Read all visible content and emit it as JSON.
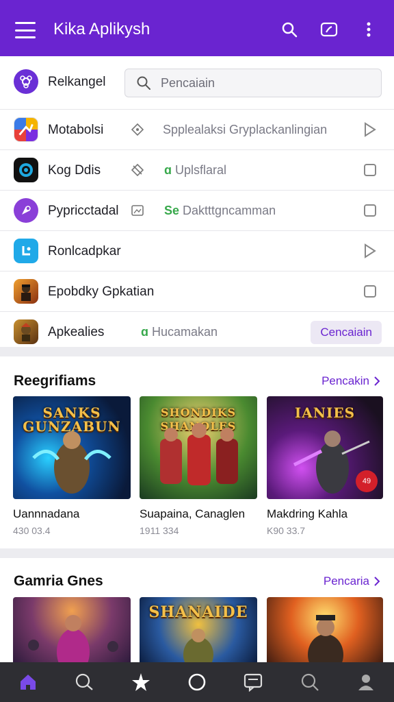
{
  "appbar": {
    "title": "Kika Aplikysh",
    "icons": [
      "menu-icon",
      "search-icon",
      "cast-icon",
      "more-vert-icon"
    ]
  },
  "search": {
    "placeholder": "Pencaiain"
  },
  "rows": [
    {
      "label": "Relkangel",
      "icon": "app-icon-purple"
    },
    {
      "label": "Motabolsi",
      "icon": "app-icon-multicolor",
      "desc": "Spplealaksi Gryplackanlingian",
      "trail": "play-icon"
    },
    {
      "label": "Kog Ddis",
      "icon": "app-icon-camera",
      "desc_prefix": "ɑ",
      "desc": "Uplsflaral",
      "trail": "checkbox-icon"
    },
    {
      "label": "Pypricctadal",
      "icon": "app-icon-violet",
      "desc_prefix": "Se",
      "desc": "Daktttgncamman",
      "trail": "checkbox-icon"
    },
    {
      "label": "Ronlcadpkar",
      "icon": "app-icon-blue",
      "trail": "play-icon"
    },
    {
      "label": "Epobdky Gpkatian",
      "icon": "app-icon-game",
      "trail": "checkbox-icon"
    },
    {
      "label": "Apkealies",
      "icon": "app-icon-game2",
      "desc_prefix": "ɑ",
      "desc": "Hucamakan",
      "button": "Cencaiain"
    }
  ],
  "sections": [
    {
      "title": "Reegrifiams",
      "link": "Pencakin",
      "games": [
        {
          "name": "Uannnadana",
          "meta": "430 03.4",
          "art_text": "SANKS GUNZABUN"
        },
        {
          "name": "Suapaina, Canaglen",
          "meta": "1911 334",
          "art_text": "SHONDIKS SHANOLES"
        },
        {
          "name": "Makdring Kahla",
          "meta": "K90 33.7",
          "art_text": "IANIES",
          "badge": "49"
        }
      ]
    },
    {
      "title": "Gamria Gnes",
      "link": "Pencaria",
      "games": [
        {
          "name": "",
          "meta": ""
        },
        {
          "name": "",
          "meta": "",
          "art_text": "SHANAIDE"
        },
        {
          "name": "",
          "meta": ""
        }
      ]
    }
  ],
  "bottom_nav": [
    "home-icon",
    "chat-search-icon",
    "star-icon",
    "circle-icon",
    "message-icon",
    "search-icon",
    "profile-icon"
  ],
  "colors": {
    "primary": "#6a24d0",
    "nav_bg": "#2e2e33",
    "accent_green": "#37a84b"
  }
}
